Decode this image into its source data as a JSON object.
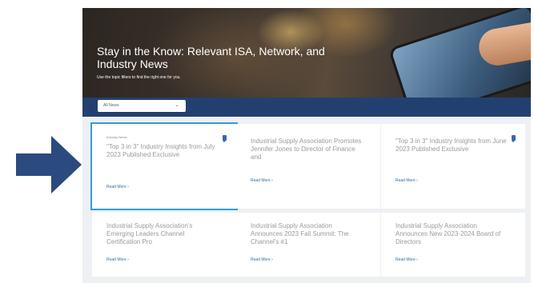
{
  "hero": {
    "title": "Stay in the Know: Relevant ISA, Network, and Industry News",
    "subtitle": "Use the topic filters to find the right one for you."
  },
  "filter": {
    "selected": "All News",
    "chevron_icon": "chevron-down-icon"
  },
  "cards": [
    {
      "tag": "Industry News",
      "title": "\"Top 3 in 3\" Industry Insights from July 2023 Published Exclusive",
      "more": "Read More",
      "pinned": true,
      "highlighted": true
    },
    {
      "tag": "",
      "title": "Industrial Supply Association Promotes Jennifer Jones to Director of Finance and",
      "more": "Read More",
      "pinned": false,
      "highlighted": false
    },
    {
      "tag": "",
      "title": "\"Top 3 in 3\" Industry Insights from June 2023 Published Exclusive",
      "more": "Read More",
      "pinned": true,
      "highlighted": false
    },
    {
      "tag": "",
      "title": "Industrial Supply Association's Emerging Leaders Channel Certification Pro",
      "more": "Read More",
      "pinned": false,
      "highlighted": false
    },
    {
      "tag": "",
      "title": "Industrial Supply Association Announces 2023 Fall Summit: The Channel's #1",
      "more": "Read More",
      "pinned": false,
      "highlighted": false
    },
    {
      "tag": "",
      "title": "Industrial Supply Association Announces New 2023-2024 Board of Directors",
      "more": "Read More",
      "pinned": false,
      "highlighted": false
    }
  ],
  "colors": {
    "accent_navy": "#22406f",
    "highlight_border": "#2e9fd6",
    "arrow": "#2a4a80",
    "link": "#3a67a8"
  }
}
